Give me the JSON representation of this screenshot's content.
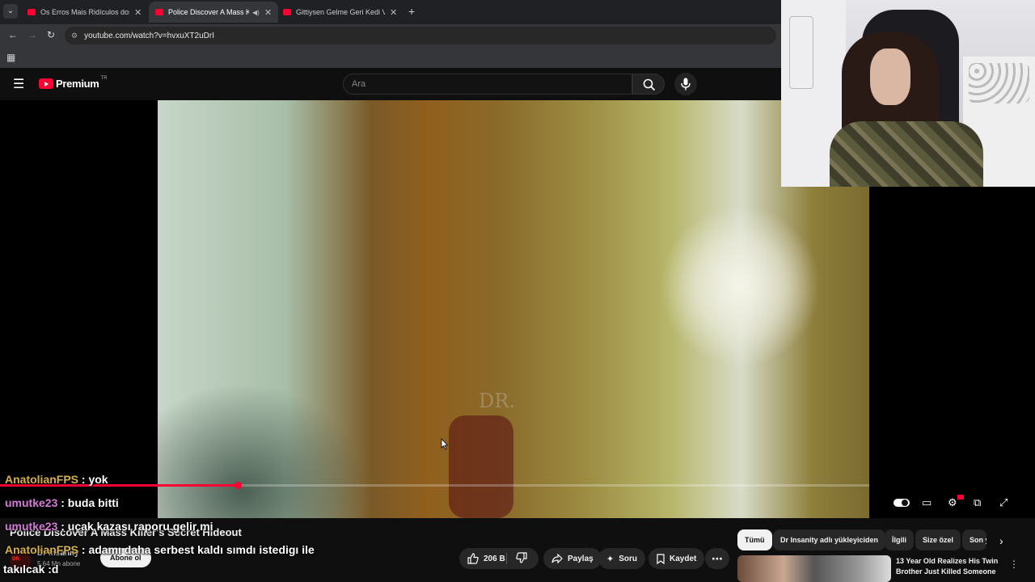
{
  "browser": {
    "tabs": [
      {
        "title": "Os Erros Mais Ridículos dos Tra"
      },
      {
        "title": "Police Discover A Mass Kille"
      },
      {
        "title": "Gittiysen Gelme Geri Kedi Versi"
      }
    ],
    "url": "youtube.com/watch?v=hvxuXT2uDrI"
  },
  "youtube": {
    "logo_text": "Premium",
    "country": "TR",
    "search_placeholder": "Ara"
  },
  "video": {
    "watermark": "DR.",
    "progress_fraction": 0.113
  },
  "below": {
    "title": "Police Discover A Mass Killer's Secret Hideout",
    "channel_name": "Dr Insanity",
    "subscribers": "5.64 Mn abone",
    "subscribe_label": "Abone ol",
    "like_count": "206 B",
    "share_label": "Paylaş",
    "ask_label": "Soru",
    "save_label": "Kaydet",
    "chips": [
      "Tümü",
      "Dr Insanity adlı yükleyiciden",
      "İlgili",
      "Size özel",
      "Son y"
    ],
    "recommended": {
      "title": "13 Year Old Realizes His Twin Brother Just Killed Someone"
    }
  },
  "chat": [
    {
      "user": "AnatolianFPS",
      "message": ": yok",
      "color": "#d6b04a"
    },
    {
      "user": "umutke23",
      "message": ": buda bitti",
      "color": "#d67ad9"
    },
    {
      "user": "umutke23",
      "message": ": uçak kazası raporu gelir mi",
      "color": "#d67ad9"
    },
    {
      "user": "AnatolianFPS",
      "message": ": adamı daha serbest kaldı sımdı istedigı ile",
      "color": "#d6b04a"
    },
    {
      "user": "",
      "message": "takılcak :d",
      "color": "#ffffff"
    }
  ],
  "colors": {
    "accent": "#ff0033",
    "background": "#0f0f0f"
  }
}
